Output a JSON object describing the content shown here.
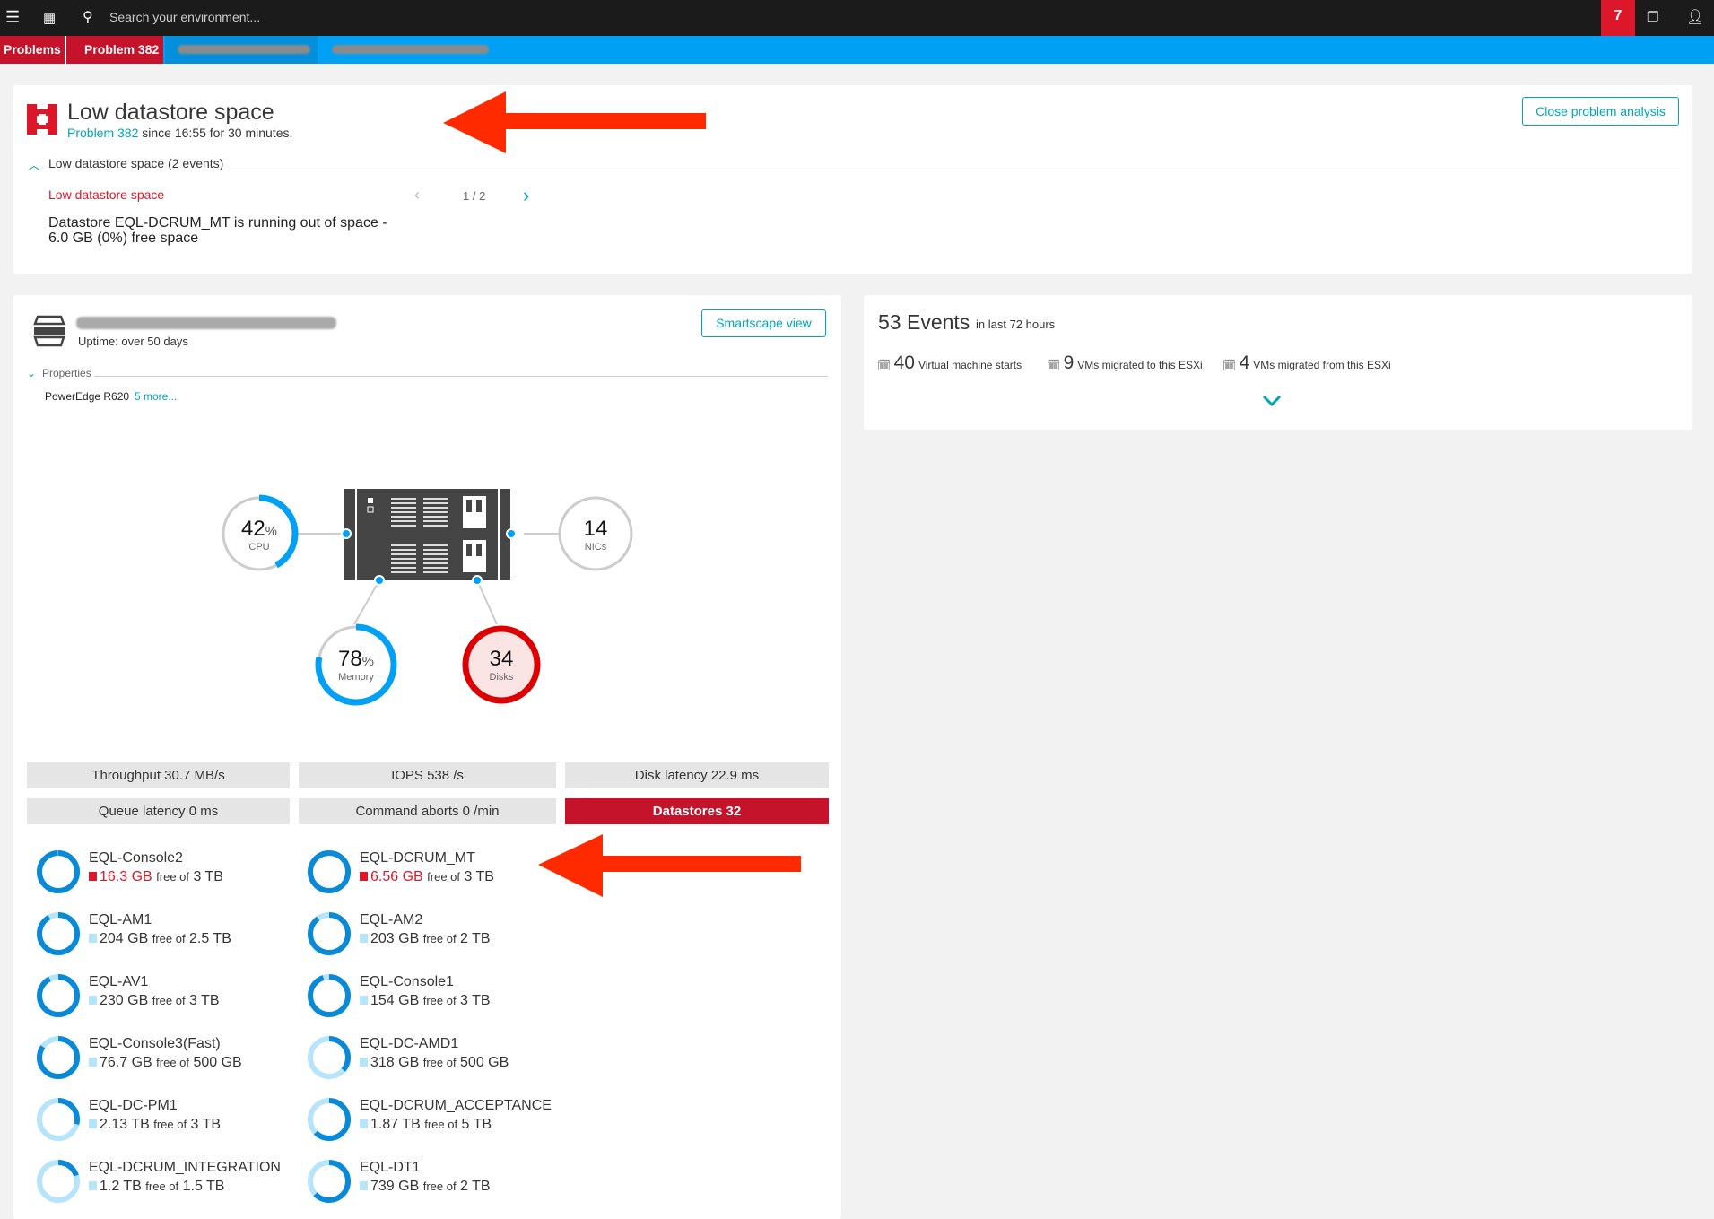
{
  "topbar": {
    "search_placeholder": "Search your environment...",
    "problem_count": "7",
    "icons": [
      "menu-icon",
      "dashboard-icon",
      "search-icon",
      "windows-icon",
      "user-icon"
    ]
  },
  "breadcrumb": [
    {
      "label": "Problems"
    },
    {
      "label": "Problem 382"
    },
    {
      "label": "redacted"
    },
    {
      "label": "redacted"
    }
  ],
  "problem": {
    "title": "Low datastore space",
    "link": "Problem 382",
    "since": " since 16:55 for 30 minutes.",
    "close_label": "Close problem analysis",
    "section": "Low datastore space (2 events)",
    "event_title": "Low datastore space",
    "pager": "1 / 2",
    "description_line1": "Datastore EQL-DCRUM_MT is running out of space -",
    "description_line2": "6.0 GB (0%) free space"
  },
  "host": {
    "uptime": "Uptime: over 50 days",
    "smartscape_label": "Smartscape view",
    "properties_label": "Properties",
    "model": "PowerEdge R620",
    "more_link": "5 more..."
  },
  "gauges": {
    "cpu": {
      "value": "42",
      "unit": "%",
      "label": "CPU",
      "percent": 42
    },
    "memory": {
      "value": "78",
      "unit": "%",
      "label": "Memory",
      "percent": 78
    },
    "nics": {
      "value": "14",
      "label": "NICs"
    },
    "disks": {
      "value": "34",
      "label": "Disks"
    }
  },
  "metrics": [
    {
      "label": "Throughput 30.7 MB/s"
    },
    {
      "label": "IOPS 538 /s"
    },
    {
      "label": "Disk latency 22.9 ms"
    },
    {
      "label": "Queue latency 0 ms"
    },
    {
      "label": "Command aborts 0 /min"
    },
    {
      "label": "Datastores 32",
      "alert": true
    }
  ],
  "free_of": "free of",
  "datastores": [
    {
      "name": "EQL-Console2",
      "free": "16.3 GB",
      "total": "3 TB",
      "critical": true
    },
    {
      "name": "EQL-DCRUM_MT",
      "free": "6.56 GB",
      "total": "3 TB",
      "critical": true
    },
    {
      "name": "EQL-AM1",
      "free": "204 GB",
      "total": "2.5 TB"
    },
    {
      "name": "EQL-AM2",
      "free": "203 GB",
      "total": "2 TB"
    },
    {
      "name": "EQL-AV1",
      "free": "230 GB",
      "total": "3 TB"
    },
    {
      "name": "EQL-Console1",
      "free": "154 GB",
      "total": "3 TB"
    },
    {
      "name": "EQL-Console3(Fast)",
      "free": "76.7 GB",
      "total": "500 GB"
    },
    {
      "name": "EQL-DC-AMD1",
      "free": "318 GB",
      "total": "500 GB"
    },
    {
      "name": "EQL-DC-PM1",
      "free": "2.13 TB",
      "total": "3 TB"
    },
    {
      "name": "EQL-DCRUM_ACCEPTANCE",
      "free": "1.87 TB",
      "total": "5 TB"
    },
    {
      "name": "EQL-DCRUM_INTEGRATION",
      "free": "1.2 TB",
      "total": "1.5 TB"
    },
    {
      "name": "EQL-DT1",
      "free": "739 GB",
      "total": "2 TB"
    }
  ],
  "events": {
    "count": "53 Events",
    "period": "in last 72 hours",
    "stats": [
      {
        "n": "40",
        "t": "Virtual machine starts"
      },
      {
        "n": "9",
        "t": "VMs migrated to this ESXi"
      },
      {
        "n": "4",
        "t": "VMs migrated from this ESXi"
      }
    ]
  },
  "colors": {
    "accent": "#00a6b5",
    "breadcrumb_blue": "#00a1f5",
    "alert_red": "#c4132b",
    "used_blue": "#0a8ad6",
    "free_blue": "#b6e4fa",
    "gauge_blue": "#00a1f5",
    "annotation_arrow": "#ff2a00"
  }
}
